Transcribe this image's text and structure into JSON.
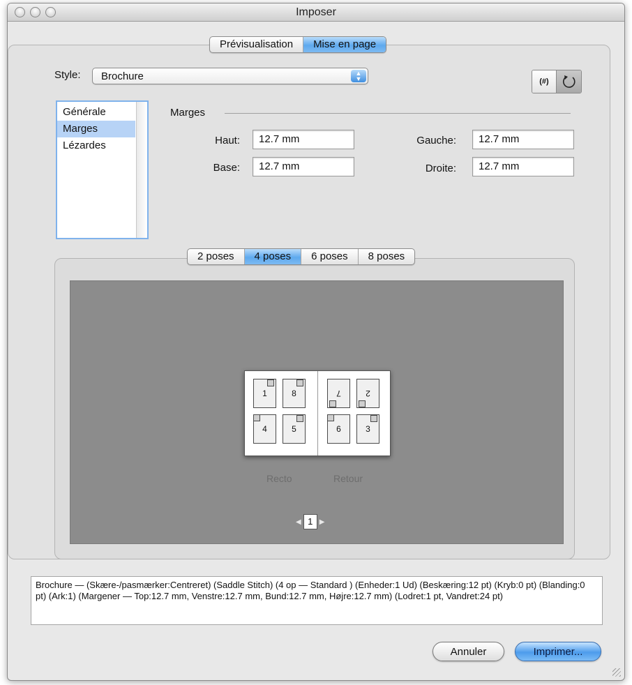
{
  "window": {
    "title": "Imposer"
  },
  "top_tabs": [
    {
      "label": "Prévisualisation",
      "active": false
    },
    {
      "label": "Mise en page",
      "active": true
    }
  ],
  "style": {
    "label": "Style:",
    "value": "Brochure"
  },
  "toolbar_icons": [
    {
      "icon": "hash-icon",
      "text": "(#)"
    },
    {
      "icon": "reset-icon"
    }
  ],
  "categories": [
    {
      "label": "Générale",
      "selected": false
    },
    {
      "label": "Marges",
      "selected": true
    },
    {
      "label": "Lézardes",
      "selected": false
    }
  ],
  "margins": {
    "title": "Marges",
    "top": {
      "label": "Haut:",
      "value": "12.7 mm"
    },
    "bottom": {
      "label": "Base:",
      "value": "12.7 mm"
    },
    "left": {
      "label": "Gauche:",
      "value": "12.7 mm"
    },
    "right": {
      "label": "Droite:",
      "value": "12.7 mm"
    }
  },
  "pose_tabs": [
    {
      "label": "2 poses",
      "active": false
    },
    {
      "label": "4 poses",
      "active": true
    },
    {
      "label": "6 poses",
      "active": false
    },
    {
      "label": "8 poses",
      "active": false
    }
  ],
  "preview": {
    "pages_front": [
      "1",
      "8",
      "4",
      "5"
    ],
    "pages_back": [
      "7",
      "2",
      "6",
      "3"
    ],
    "front_label": "Recto",
    "back_label": "Retour",
    "page_number": "1"
  },
  "summary": "Brochure — (Skære-/pasmærker:Centreret) (Saddle Stitch) (4 op — Standard ) (Enheder:1 Ud) (Beskæring:12 pt) (Kryb:0 pt) (Blanding:0 pt) (Ark:1) (Margener — Top:12.7 mm, Venstre:12.7 mm, Bund:12.7 mm, Højre:12.7 mm) (Lodret:1 pt, Vandret:24 pt)",
  "buttons": {
    "cancel": "Annuler",
    "print": "Imprimer..."
  },
  "colors": {
    "accent": "#5ea9ee",
    "selection": "#b7d3f6",
    "preview_bg": "#8c8c8c"
  }
}
